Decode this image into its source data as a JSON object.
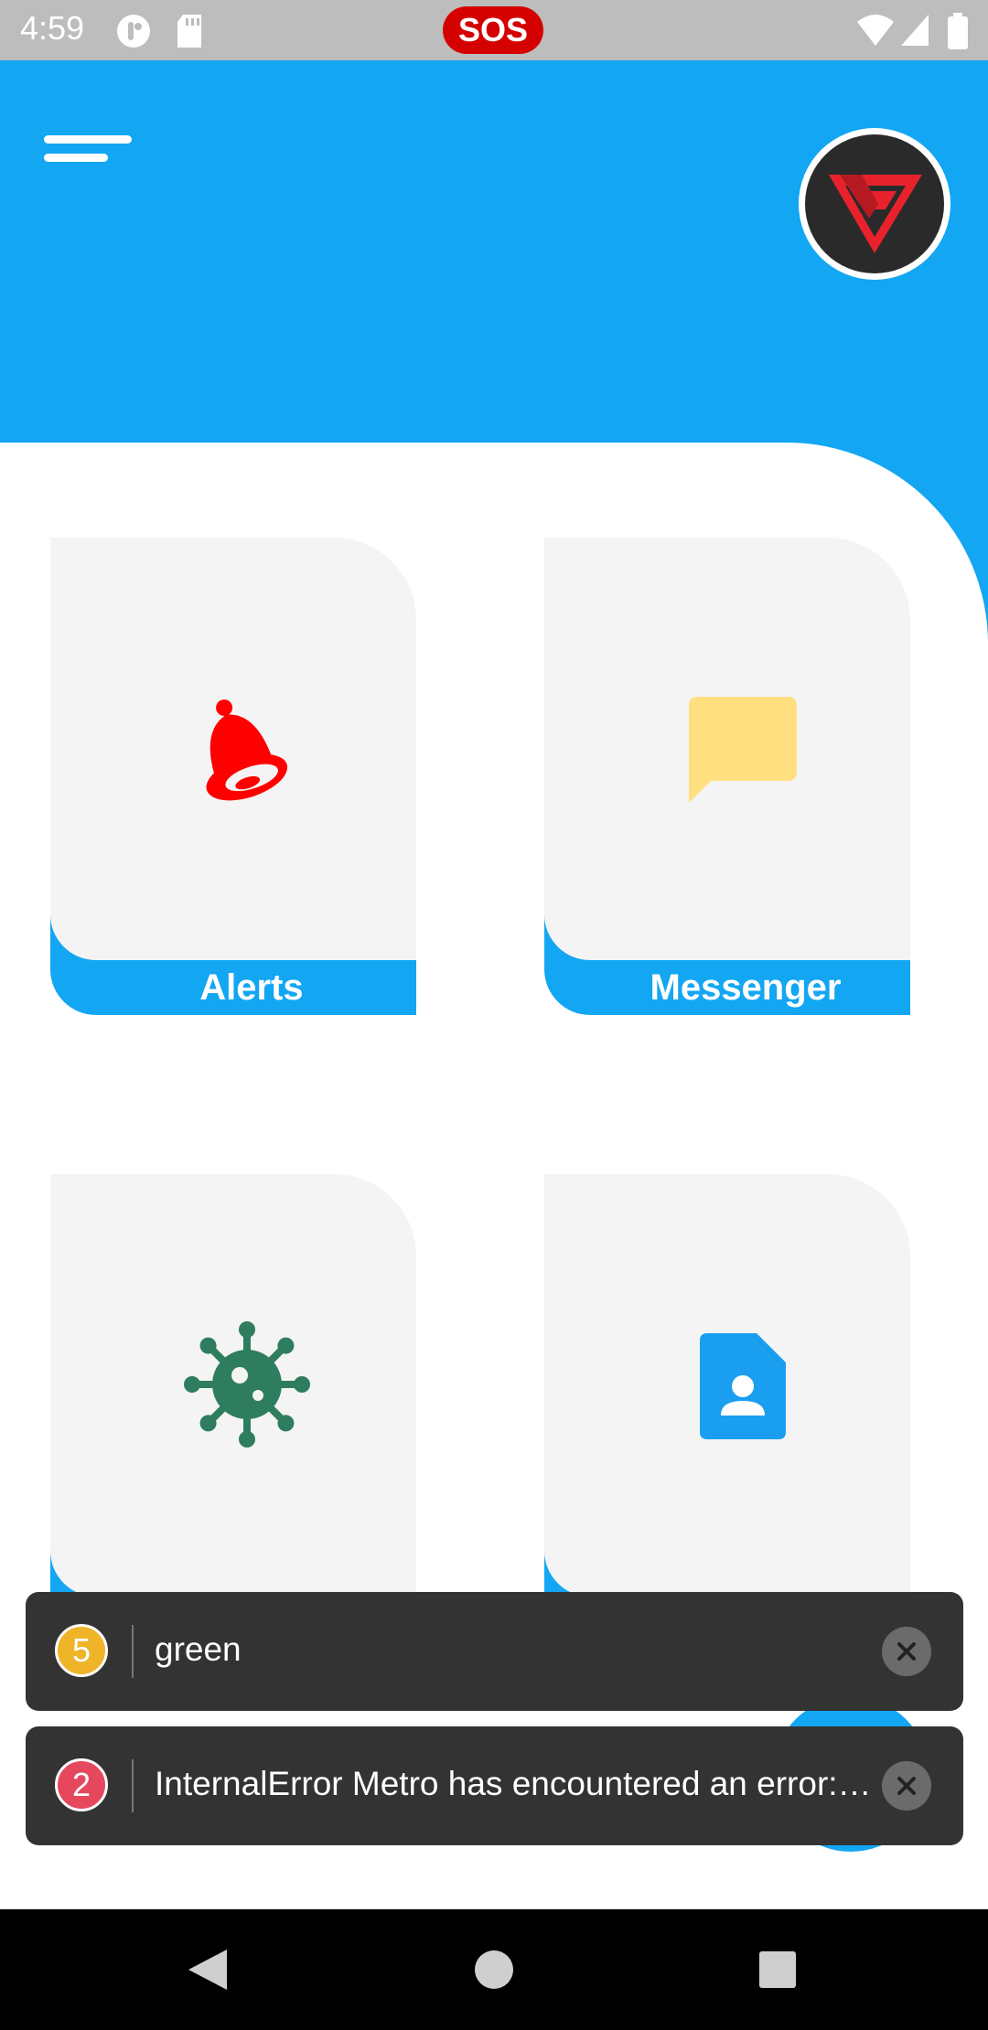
{
  "status_bar": {
    "time": "4:59",
    "sos_label": "SOS"
  },
  "header": {
    "accent_color": "#13a6f3"
  },
  "tiles": [
    {
      "label": "Alerts",
      "icon": "bell-icon",
      "icon_color": "#ff0000"
    },
    {
      "label": "Messenger",
      "icon": "chat-bubble-icon",
      "icon_color": "#ffdf80"
    },
    {
      "label": "",
      "icon": "virus-icon",
      "icon_color": "#2e7d5e"
    },
    {
      "label": "",
      "icon": "contact-file-icon",
      "icon_color": "#1a9ff0"
    }
  ],
  "toasts": [
    {
      "count": "5",
      "badge_color": "#f0b429",
      "message": "green"
    },
    {
      "count": "2",
      "badge_color": "#e5485d",
      "message": "InternalError Metro has encountered an error: While trying to resolve module"
    }
  ]
}
